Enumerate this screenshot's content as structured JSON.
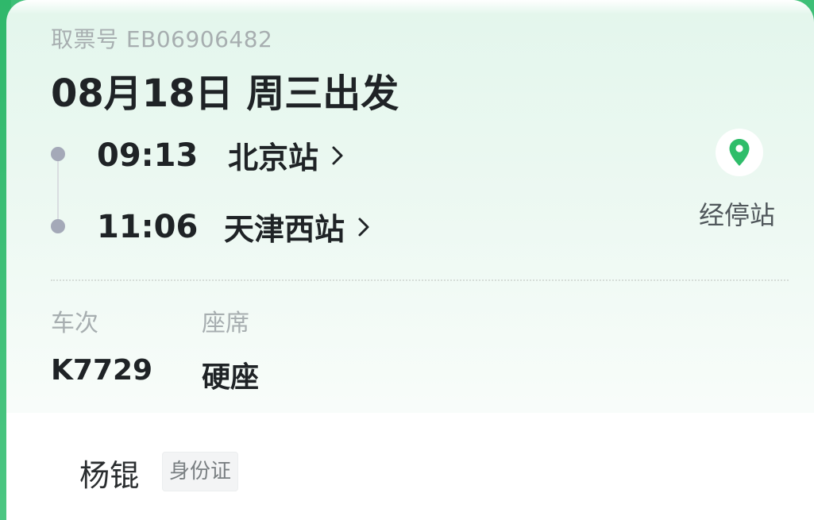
{
  "ticket": {
    "pickup_label": "取票号",
    "pickup_number": "EB06906482",
    "departure": "08月18日 周三出发",
    "stops": [
      {
        "time": "09:13",
        "station": "北京站"
      },
      {
        "time": "11:06",
        "station": "天津西站"
      }
    ],
    "stopover_label": "经停站",
    "train_label": "车次",
    "train_number": "K7729",
    "seat_label": "座席",
    "seat_type": "硬座"
  },
  "passenger": {
    "name": "杨锟",
    "id_type": "身份证"
  },
  "icons": {
    "pin": "map-pin-icon",
    "chevron": "chevron-right-icon"
  },
  "colors": {
    "accent": "#3dbf77",
    "pin": "#2fbd6a"
  }
}
